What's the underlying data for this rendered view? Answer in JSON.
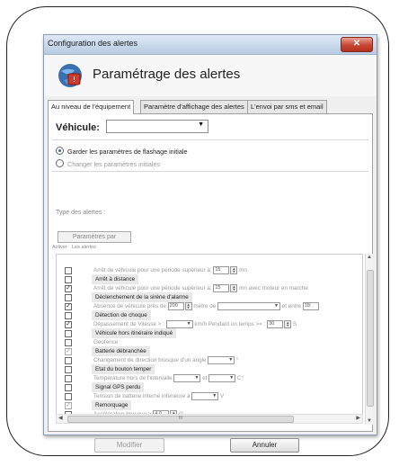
{
  "window": {
    "title": "Configuration des alertes",
    "close_glyph": "✕"
  },
  "header": {
    "title": "Paramétrage des alertes",
    "logo_icon": "alert-globe-icon"
  },
  "tabs": [
    {
      "label": "Au niveau de l'équipement",
      "active": true
    },
    {
      "label": "Paramètre d'affichage des alertes",
      "active": false
    },
    {
      "label": "L'envoi par sms et email",
      "active": false
    }
  ],
  "vehicle": {
    "label": "Véhicule:",
    "value": ""
  },
  "options": {
    "keep": "Garder les paramètres de flashage initiale",
    "change": "Changer les paramètres initiales",
    "selected": "keep"
  },
  "alert_types": {
    "label": "Type des alertes :",
    "params_button": "Paramètres par",
    "col_activate": "Activer",
    "col_alerts": "Les alertes"
  },
  "rows": [
    {
      "checked": false,
      "highlight": false,
      "pre": "Arrêt de véhicule pour une période supérieur à:",
      "field1": "15",
      "spin1": true,
      "mid": "mn",
      "field2": null,
      "post": ""
    },
    {
      "checked": false,
      "highlight": true,
      "pre": "Arrêt à distance"
    },
    {
      "checked": true,
      "highlight": false,
      "pre": "Arrêt de véhicule pour une période supérieur à:",
      "field1": "15",
      "spin1": true,
      "mid": "mn avec moteur en marche"
    },
    {
      "checked": false,
      "highlight": true,
      "pre": "Déclenchement de la sirène d'alarme"
    },
    {
      "checked": true,
      "highlight": false,
      "pre": "Absence de véhicule près de",
      "field1": "200",
      "spin1": true,
      "mid": "mètre de",
      "dropdown": true,
      "post": "et entre",
      "field2": "18:"
    },
    {
      "checked": false,
      "highlight": true,
      "pre": "Détection de choque"
    },
    {
      "checked": true,
      "highlight": false,
      "pre": "Dépassement de Vitesse > :",
      "dropdown_small": true,
      "mid": "km/h Pendant un temps >= :",
      "field2": "30",
      "spin2": true,
      "post": "S"
    },
    {
      "checked": false,
      "highlight": true,
      "pre": "Véhicule hors itinéraire indiqué"
    },
    {
      "checked": false,
      "highlight": false,
      "pre": "Géofence"
    },
    {
      "checked": true,
      "dim": true,
      "highlight": true,
      "pre": "Batterie débranchée"
    },
    {
      "checked": false,
      "highlight": false,
      "pre": "Changement de direction brusque d'un angle",
      "dropdown_small": true,
      "post": "°"
    },
    {
      "checked": false,
      "highlight": true,
      "pre": "Etat du bouton temper"
    },
    {
      "checked": false,
      "highlight": false,
      "pre": "Température hors de l'intervalle",
      "dropdown_small": true,
      "mid": "et",
      "dropdown_small2": true,
      "post": "C°"
    },
    {
      "checked": false,
      "highlight": true,
      "pre": "Signal GPS perdu"
    },
    {
      "checked": false,
      "highlight": false,
      "pre": "Tension de batterie interne inferieure à",
      "dropdown_small": true,
      "post": "V"
    },
    {
      "checked": true,
      "dim": true,
      "highlight": true,
      "pre": "Remorquage"
    },
    {
      "checked": false,
      "highlight": false,
      "pre": "Accélération brusque >",
      "field1": "4.0",
      "spin1": true,
      "mid": "G"
    }
  ],
  "scroll": {
    "h_thumb_text": "III"
  },
  "buttons": {
    "modifier": "Modifier",
    "annuler": "Annuler"
  }
}
